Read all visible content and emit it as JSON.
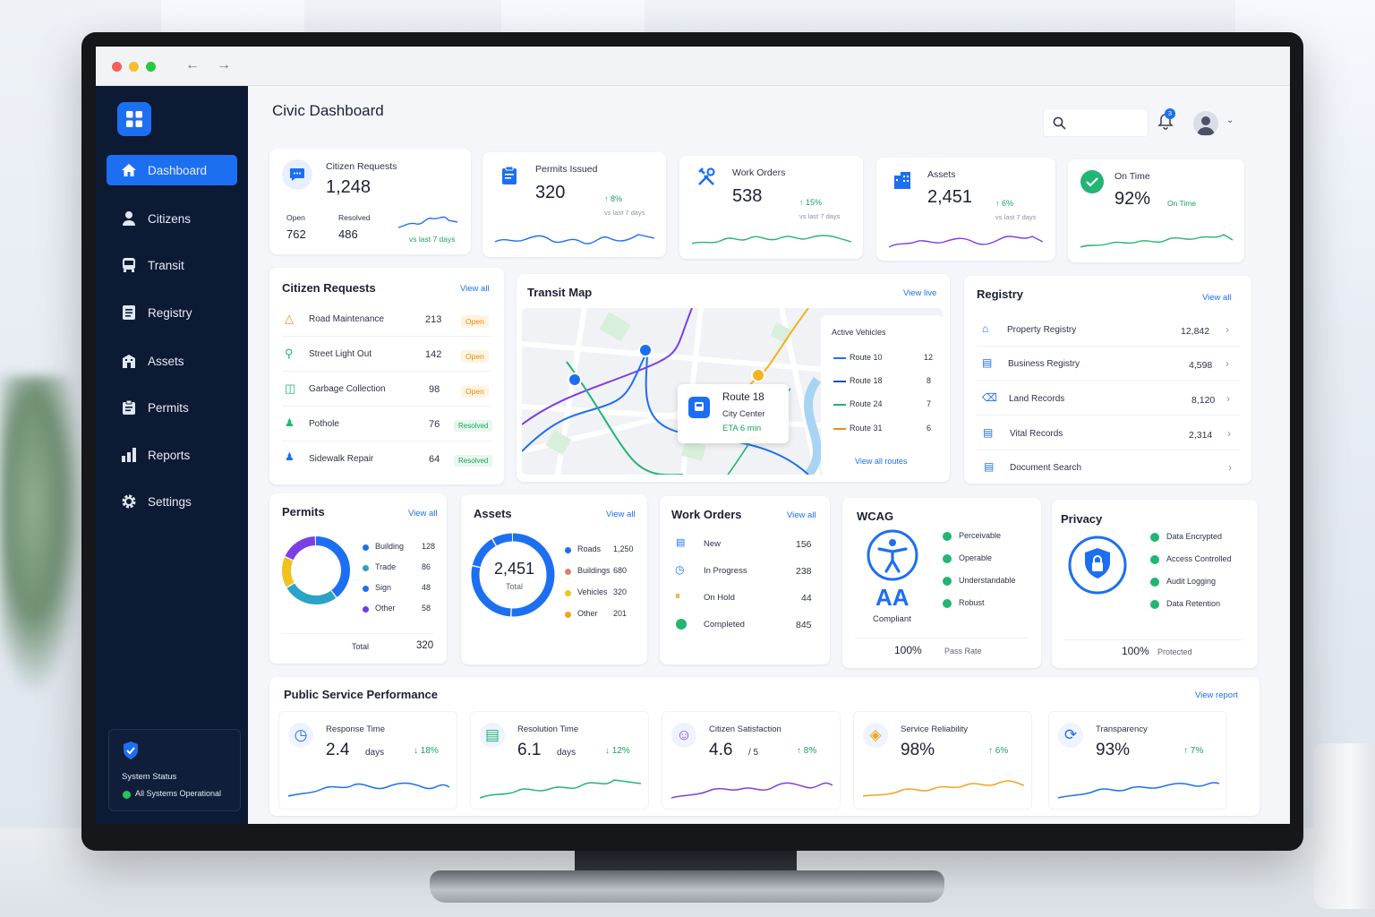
{
  "app": {
    "title": "Civic Dashboard",
    "notification_count": "3"
  },
  "sidebar": {
    "items": [
      {
        "label": "Dashboard",
        "icon": "home-icon"
      },
      {
        "label": "Citizens",
        "icon": "person-icon"
      },
      {
        "label": "Transit",
        "icon": "bus-icon"
      },
      {
        "label": "Registry",
        "icon": "document-icon"
      },
      {
        "label": "Assets",
        "icon": "building-icon"
      },
      {
        "label": "Permits",
        "icon": "clipboard-icon"
      },
      {
        "label": "Reports",
        "icon": "bar-chart-icon"
      },
      {
        "label": "Settings",
        "icon": "gear-icon"
      }
    ],
    "status_title": "System Status",
    "status_text": "All Systems Operational"
  },
  "kpis": {
    "citizen_requests": {
      "title": "Citizen Requests",
      "value": "1,248",
      "open_label": "Open",
      "open_value": "762",
      "resolved_label": "Resolved",
      "resolved_value": "486",
      "note": "vs last 7 days"
    },
    "permits": {
      "title": "Permits Issued",
      "value": "320",
      "change": "8%",
      "note": "vs last 7 days"
    },
    "work_orders": {
      "title": "Work Orders",
      "value": "538",
      "change": "15%",
      "note": "vs last 7 days"
    },
    "assets": {
      "title": "Assets",
      "value": "2,451",
      "change": "6%",
      "note": "vs last 7 days"
    },
    "on_time": {
      "title": "On Time",
      "value": "92%",
      "status": "On Time"
    }
  },
  "citizen_requests_panel": {
    "title": "Citizen Requests",
    "link": "View all",
    "rows": [
      {
        "name": "Road Maintenance",
        "count": "213",
        "status": "Open"
      },
      {
        "name": "Street Light Out",
        "count": "142",
        "status": "Open"
      },
      {
        "name": "Garbage Collection",
        "count": "98",
        "status": "Open"
      },
      {
        "name": "Pothole",
        "count": "76",
        "status": "Resolved"
      },
      {
        "name": "Sidewalk Repair",
        "count": "64",
        "status": "Resolved"
      }
    ]
  },
  "transit": {
    "title": "Transit Map",
    "link": "View live",
    "popup": {
      "route": "Route 18",
      "stop": "City Center",
      "eta": "ETA 6 min"
    },
    "active_title": "Active Vehicles",
    "routes": [
      {
        "name": "Route 10",
        "count": "12",
        "color": "#1d6ff2"
      },
      {
        "name": "Route 18",
        "count": "8",
        "color": "#1d4fb8"
      },
      {
        "name": "Route 24",
        "count": "7",
        "color": "#22b573"
      },
      {
        "name": "Route 31",
        "count": "6",
        "color": "#f08a1c"
      }
    ],
    "all_routes": "View all routes"
  },
  "registry": {
    "title": "Registry",
    "link": "View all",
    "rows": [
      {
        "name": "Property Registry",
        "value": "12,842"
      },
      {
        "name": "Business Registry",
        "value": "4,598"
      },
      {
        "name": "Land Records",
        "value": "8,120"
      },
      {
        "name": "Vital Records",
        "value": "2,314"
      },
      {
        "name": "Document Search",
        "value": ""
      }
    ]
  },
  "permits_panel": {
    "title": "Permits",
    "link": "View all",
    "items": [
      {
        "name": "Building",
        "value": "128",
        "color": "#1d6ff2"
      },
      {
        "name": "Trade",
        "value": "86",
        "color": "#29a3c7"
      },
      {
        "name": "Sign",
        "value": "48",
        "color": "#1d6ff2"
      },
      {
        "name": "Other",
        "value": "58",
        "color": "#6a3de8"
      }
    ],
    "total_label": "Total",
    "total_value": "320"
  },
  "assets_panel": {
    "title": "Assets",
    "link": "View all",
    "center_value": "2,451",
    "center_label": "Total",
    "items": [
      {
        "name": "Roads",
        "value": "1,250",
        "color": "#1d6ff2"
      },
      {
        "name": "Buildings",
        "value": "680",
        "color": "#d9826b"
      },
      {
        "name": "Vehicles",
        "value": "320",
        "color": "#f2c21c"
      },
      {
        "name": "Other",
        "value": "201",
        "color": "#f2a51c"
      }
    ]
  },
  "work_orders_panel": {
    "title": "Work Orders",
    "link": "View all",
    "items": [
      {
        "name": "New",
        "value": "156"
      },
      {
        "name": "In Progress",
        "value": "238"
      },
      {
        "name": "On Hold",
        "value": "44"
      },
      {
        "name": "Completed",
        "value": "845"
      }
    ]
  },
  "wcag": {
    "title": "WCAG",
    "level": "AA",
    "level_label": "Compliant",
    "items": [
      "Perceivable",
      "Operable",
      "Understandable",
      "Robust"
    ],
    "rate": "100%",
    "rate_label": "Pass Rate"
  },
  "privacy": {
    "title": "Privacy",
    "items": [
      "Data Encrypted",
      "Access Controlled",
      "Audit Logging",
      "Data Retention"
    ],
    "rate": "100%",
    "rate_label": "Protected"
  },
  "performance": {
    "title": "Public Service Performance",
    "link": "View report",
    "metrics": [
      {
        "title": "Response Time",
        "value": "2.4",
        "unit": "days",
        "change": "18%",
        "color": "#1d6ff2"
      },
      {
        "title": "Resolution Time",
        "value": "6.1",
        "unit": "days",
        "change": "12%",
        "color": "#22b573"
      },
      {
        "title": "Citizen Satisfaction",
        "value": "4.6",
        "unit": "/ 5",
        "change": "8%",
        "color": "#7b3fe4"
      },
      {
        "title": "Service Reliability",
        "value": "98%",
        "unit": "",
        "change": "6%",
        "color": "#f2a51c"
      },
      {
        "title": "Transparency",
        "value": "93%",
        "unit": "",
        "change": "7%",
        "color": "#1d6ff2"
      }
    ]
  }
}
